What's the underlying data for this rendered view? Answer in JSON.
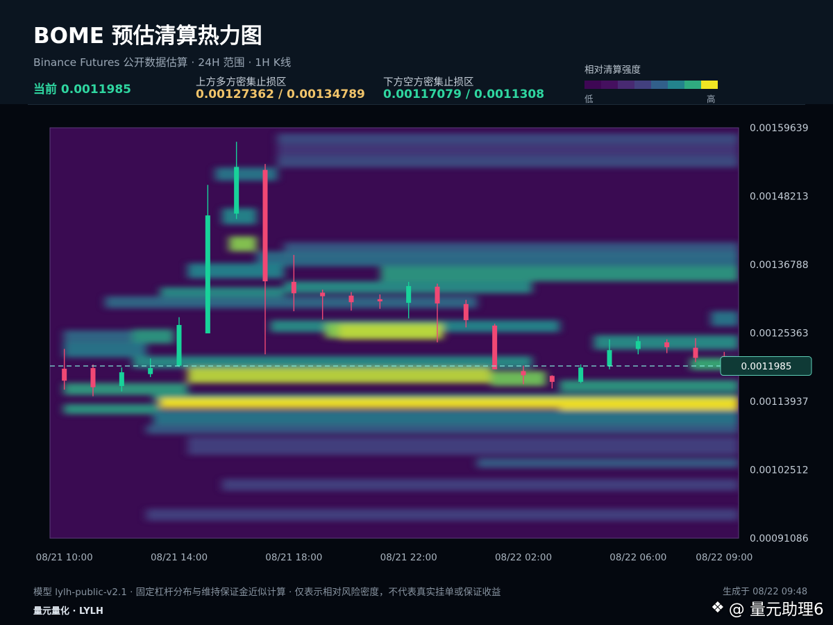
{
  "header": {
    "title": "BOME 预估清算热力图",
    "subtitle": "Binance Futures 公开数据估算 · 24H 范围 · 1H K线",
    "current": "当前 0.0011985",
    "upper_zone_label": "上方多方密集止损区",
    "upper_zone_value": "0.00127362 / 0.00134789",
    "lower_zone_label": "下方空方密集止损区",
    "lower_zone_value": "0.00117079 / 0.0011308"
  },
  "legend": {
    "title": "相对清算强度",
    "low": "低",
    "high": "高",
    "colors": [
      "#3e0754",
      "#45105f",
      "#482a72",
      "#42407e",
      "#315f8a",
      "#23838c",
      "#2fab7f",
      "#f0e523"
    ]
  },
  "colors": {
    "bull": "#18d29a",
    "bear": "#f04874",
    "current_line": "#7fe6d8",
    "price_tag_bg": "#0f3a36",
    "price_tag_border": "#5fd0b8"
  },
  "chart_data": {
    "type": "heatmap",
    "ylim": [
      0.00091086,
      0.00159639
    ],
    "yticks": [
      "0.00159639",
      "0.00148213",
      "0.00136788",
      "0.00125363",
      "0.00113937",
      "0.00102512",
      "0.00091086"
    ],
    "xticks": [
      "08/21 10:00",
      "08/21 14:00",
      "08/21 18:00",
      "08/21 22:00",
      "08/22 02:00",
      "08/22 06:00",
      "08/22 09:00"
    ],
    "current_price": 0.0011985,
    "current_price_label": "0.0011985",
    "candles": [
      {
        "o": 0.001194,
        "c": 0.001174,
        "h": 0.001227,
        "l": 0.001159
      },
      {
        "o": 0.001195,
        "c": 0.001163,
        "h": 0.001201,
        "l": 0.001148
      },
      {
        "o": 0.001165,
        "c": 0.001188,
        "h": 0.001196,
        "l": 0.001156
      },
      {
        "o": 0.001185,
        "c": 0.001195,
        "h": 0.001211,
        "l": 0.00118
      },
      {
        "o": 0.001199,
        "c": 0.001267,
        "h": 0.00128,
        "l": 0.001197
      },
      {
        "o": 0.001253,
        "c": 0.00145,
        "h": 0.001501,
        "l": 0.001253
      },
      {
        "o": 0.001453,
        "c": 0.001531,
        "h": 0.001573,
        "l": 0.001444
      },
      {
        "o": 0.001526,
        "c": 0.00134,
        "h": 0.001536,
        "l": 0.001218
      },
      {
        "o": 0.001339,
        "c": 0.00132,
        "h": 0.001384,
        "l": 0.00129
      },
      {
        "o": 0.001321,
        "c": 0.001315,
        "h": 0.001326,
        "l": 0.001276
      },
      {
        "o": 0.001316,
        "c": 0.001305,
        "h": 0.001322,
        "l": 0.001291
      },
      {
        "o": 0.00131,
        "c": 0.001308,
        "h": 0.001318,
        "l": 0.001294
      },
      {
        "o": 0.001304,
        "c": 0.001332,
        "h": 0.001339,
        "l": 0.001278
      },
      {
        "o": 0.001331,
        "c": 0.001303,
        "h": 0.001336,
        "l": 0.001238
      },
      {
        "o": 0.001302,
        "c": 0.001275,
        "h": 0.001309,
        "l": 0.001263
      },
      {
        "o": 0.001266,
        "c": 0.001193,
        "h": 0.001269,
        "l": 0.001193
      },
      {
        "o": 0.00119,
        "c": 0.001183,
        "h": 0.001199,
        "l": 0.001168
      },
      {
        "o": 0.001182,
        "c": 0.001172,
        "h": 0.001183,
        "l": 0.001161
      },
      {
        "o": 0.001172,
        "c": 0.001196,
        "h": 0.001201,
        "l": 0.00117
      },
      {
        "o": 0.001198,
        "c": 0.001225,
        "h": 0.001243,
        "l": 0.001193
      },
      {
        "o": 0.001227,
        "c": 0.00124,
        "h": 0.001248,
        "l": 0.001218
      },
      {
        "o": 0.001238,
        "c": 0.00123,
        "h": 0.001243,
        "l": 0.00122
      },
      {
        "o": 0.001229,
        "c": 0.001212,
        "h": 0.001245,
        "l": 0.001205
      },
      {
        "o": 0.001215,
        "c": 0.001205,
        "h": 0.001222,
        "l": 0.001196
      }
    ],
    "bands": [
      {
        "y0": 0.001587,
        "y1": 0.00157,
        "i": 0.3,
        "s": 0.33,
        "e": 1.0
      },
      {
        "y0": 0.00157,
        "y1": 0.001549,
        "i": 0.22,
        "s": 0.33,
        "e": 1.0
      },
      {
        "y0": 0.001549,
        "y1": 0.00153,
        "i": 0.3,
        "s": 0.33,
        "e": 1.0
      },
      {
        "y0": 0.00153,
        "y1": 0.001508,
        "i": 0.45,
        "s": 0.24,
        "e": 0.33
      },
      {
        "y0": 0.001462,
        "y1": 0.001435,
        "i": 0.52,
        "s": 0.25,
        "e": 0.3
      },
      {
        "y0": 0.001405,
        "y1": 0.00138,
        "i": 0.35,
        "s": 0.34,
        "e": 1.0
      },
      {
        "y0": 0.001415,
        "y1": 0.00139,
        "i": 0.85,
        "s": 0.26,
        "e": 0.3
      },
      {
        "y0": 0.00139,
        "y1": 0.001365,
        "i": 0.42,
        "s": 0.3,
        "e": 1.0
      },
      {
        "y0": 0.001365,
        "y1": 0.00134,
        "i": 0.6,
        "s": 0.48,
        "e": 1.0
      },
      {
        "y0": 0.00137,
        "y1": 0.001345,
        "i": 0.5,
        "s": 0.2,
        "e": 0.34
      },
      {
        "y0": 0.00134,
        "y1": 0.00132,
        "i": 0.55,
        "s": 0.34,
        "e": 0.7
      },
      {
        "y0": 0.00133,
        "y1": 0.001305,
        "i": 0.55,
        "s": 0.16,
        "e": 0.34
      },
      {
        "y0": 0.001315,
        "y1": 0.001295,
        "i": 0.4,
        "s": 0.08,
        "e": 0.62
      },
      {
        "y0": 0.00129,
        "y1": 0.001265,
        "i": 0.45,
        "s": 0.96,
        "e": 1.0
      },
      {
        "y0": 0.001275,
        "y1": 0.001255,
        "i": 0.55,
        "s": 0.32,
        "e": 0.58
      },
      {
        "y0": 0.001275,
        "y1": 0.001255,
        "i": 0.52,
        "s": 0.58,
        "e": 0.74
      },
      {
        "y0": 0.00127,
        "y1": 0.001245,
        "i": 0.85,
        "s": 0.4,
        "e": 0.57
      },
      {
        "y0": 0.001268,
        "y1": 0.001243,
        "i": 0.92,
        "s": 0.42,
        "e": 0.57
      },
      {
        "y0": 0.00126,
        "y1": 0.001236,
        "i": 0.6,
        "s": 0.12,
        "e": 0.18
      },
      {
        "y0": 0.001258,
        "y1": 0.001238,
        "i": 0.4,
        "s": 0.02,
        "e": 0.12
      },
      {
        "y0": 0.00125,
        "y1": 0.001226,
        "i": 0.55,
        "s": 0.79,
        "e": 1.0
      },
      {
        "y0": 0.001238,
        "y1": 0.001213,
        "i": 0.45,
        "s": 0.02,
        "e": 0.14
      },
      {
        "y0": 0.001215,
        "y1": 0.001195,
        "i": 0.55,
        "s": 0.12,
        "e": 0.7
      },
      {
        "y0": 0.001212,
        "y1": 0.001192,
        "i": 0.7,
        "s": 0.93,
        "e": 1.0
      },
      {
        "y0": 0.001195,
        "y1": 0.00117,
        "i": 0.92,
        "s": 0.2,
        "e": 0.64
      },
      {
        "y0": 0.00119,
        "y1": 0.001165,
        "i": 0.82,
        "s": 0.64,
        "e": 0.72
      },
      {
        "y0": 0.001175,
        "y1": 0.001155,
        "i": 0.6,
        "s": 0.74,
        "e": 1.0
      },
      {
        "y0": 0.00117,
        "y1": 0.00115,
        "i": 0.62,
        "s": 0.02,
        "e": 0.2
      },
      {
        "y0": 0.001152,
        "y1": 0.001138,
        "i": 0.6,
        "s": 0.15,
        "e": 1.0
      },
      {
        "y0": 0.001145,
        "y1": 0.001128,
        "i": 1.0,
        "s": 0.16,
        "e": 0.74
      },
      {
        "y0": 0.001145,
        "y1": 0.001125,
        "i": 1.0,
        "s": 0.74,
        "e": 1.0
      },
      {
        "y0": 0.001135,
        "y1": 0.001118,
        "i": 0.6,
        "s": 0.02,
        "e": 0.16
      },
      {
        "y0": 0.001125,
        "y1": 0.0011,
        "i": 0.45,
        "s": 0.15,
        "e": 1.0
      },
      {
        "y0": 0.0011,
        "y1": 0.001085,
        "i": 0.35,
        "s": 0.14,
        "e": 1.0
      },
      {
        "y0": 0.00108,
        "y1": 0.00105,
        "i": 0.25,
        "s": 0.2,
        "e": 1.0
      },
      {
        "y0": 0.001045,
        "y1": 0.001028,
        "i": 0.35,
        "s": 0.62,
        "e": 1.0
      },
      {
        "y0": 0.00101,
        "y1": 0.00099,
        "i": 0.25,
        "s": 0.25,
        "e": 1.0
      },
      {
        "y0": 0.00096,
        "y1": 0.00094,
        "i": 0.25,
        "s": 0.14,
        "e": 1.0
      }
    ]
  },
  "footer": {
    "note": "模型 lylh-public-v2.1 · 固定杠杆分布与维持保证金近似计算 · 仅表示相对风险密度，不代表真实挂单或保证收益",
    "brand": "量元量化 · LYLH",
    "generated": "生成于 08/22 09:48",
    "watermark": "@ 量元助理6"
  }
}
